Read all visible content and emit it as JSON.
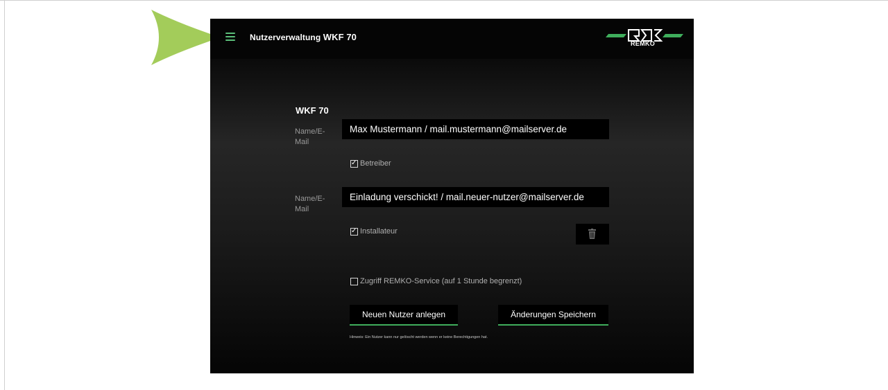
{
  "header": {
    "title": "Nutzerverwaltung",
    "device": "WKF 70",
    "logo_text": "REMKO",
    "menu_icon": "hamburger-menu-icon",
    "accent_color": "#3fae5c"
  },
  "main": {
    "device_heading": "WKF 70",
    "users": [
      {
        "label": "Name/E-Mail",
        "value": "Max Mustermann / mail.mustermann@mailserver.de",
        "role_label": "Betreiber",
        "role_checked": true
      },
      {
        "label": "Name/E-Mail",
        "value": "Einladung verschickt! / mail.neuer-nutzer@mailserver.de",
        "role_label": "Installateur",
        "role_checked": true,
        "delete_icon": "trash-icon"
      }
    ],
    "service_access": {
      "label": "Zugriff REMKO-Service (auf 1 Stunde begrenzt)",
      "checked": false
    },
    "buttons": {
      "new_user": "Neuen Nutzer anlegen",
      "save": "Änderungen Speichern"
    },
    "hint": "Hinweis: Ein Nutzer kann nur gelöscht werden wenn er keine Berechtigungen hat."
  },
  "annotation": {
    "pointer_color": "#a3cc5a"
  }
}
